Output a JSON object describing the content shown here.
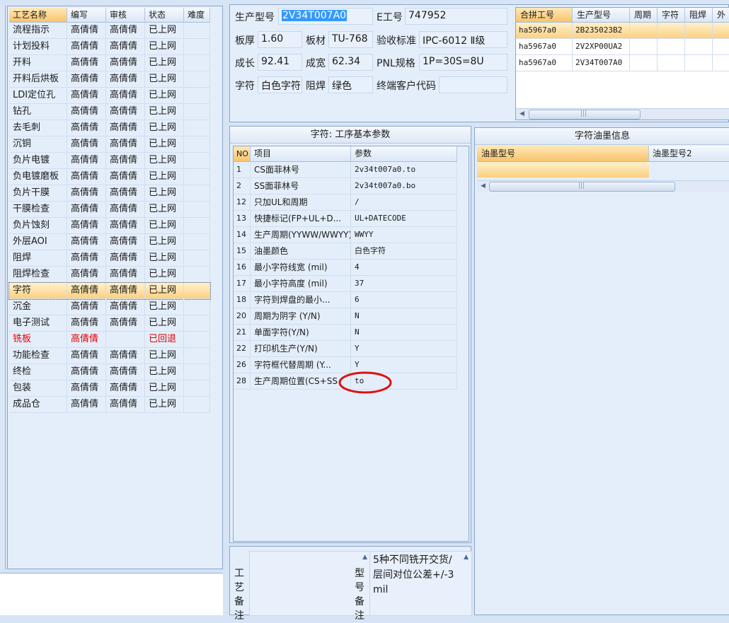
{
  "process_list": {
    "columns": [
      "工艺名称",
      "编写",
      "审核",
      "状态",
      "难度"
    ],
    "rows": [
      {
        "name": "流程指示",
        "writer": "高倩倩",
        "reviewer": "高倩倩",
        "status": "已上网"
      },
      {
        "name": "计划投料",
        "writer": "高倩倩",
        "reviewer": "高倩倩",
        "status": "已上网"
      },
      {
        "name": "开料",
        "writer": "高倩倩",
        "reviewer": "高倩倩",
        "status": "已上网"
      },
      {
        "name": "开料后烘板",
        "writer": "高倩倩",
        "reviewer": "高倩倩",
        "status": "已上网"
      },
      {
        "name": "LDI定位孔",
        "writer": "高倩倩",
        "reviewer": "高倩倩",
        "status": "已上网"
      },
      {
        "name": "钻孔",
        "writer": "高倩倩",
        "reviewer": "高倩倩",
        "status": "已上网"
      },
      {
        "name": "去毛刺",
        "writer": "高倩倩",
        "reviewer": "高倩倩",
        "status": "已上网"
      },
      {
        "name": "沉铜",
        "writer": "高倩倩",
        "reviewer": "高倩倩",
        "status": "已上网"
      },
      {
        "name": "负片电镀",
        "writer": "高倩倩",
        "reviewer": "高倩倩",
        "status": "已上网"
      },
      {
        "name": "负电镀磨板",
        "writer": "高倩倩",
        "reviewer": "高倩倩",
        "status": "已上网"
      },
      {
        "name": "负片干膜",
        "writer": "高倩倩",
        "reviewer": "高倩倩",
        "status": "已上网"
      },
      {
        "name": "干膜检查",
        "writer": "高倩倩",
        "reviewer": "高倩倩",
        "status": "已上网"
      },
      {
        "name": "负片蚀刻",
        "writer": "高倩倩",
        "reviewer": "高倩倩",
        "status": "已上网"
      },
      {
        "name": "外层AOI",
        "writer": "高倩倩",
        "reviewer": "高倩倩",
        "status": "已上网"
      },
      {
        "name": "阻焊",
        "writer": "高倩倩",
        "reviewer": "高倩倩",
        "status": "已上网"
      },
      {
        "name": "阻焊检查",
        "writer": "高倩倩",
        "reviewer": "高倩倩",
        "status": "已上网"
      },
      {
        "name": "字符",
        "writer": "高倩倩",
        "reviewer": "高倩倩",
        "status": "已上网",
        "selected": true
      },
      {
        "name": "沉金",
        "writer": "高倩倩",
        "reviewer": "高倩倩",
        "status": "已上网"
      },
      {
        "name": "电子测试",
        "writer": "高倩倩",
        "reviewer": "高倩倩",
        "status": "已上网"
      },
      {
        "name": "铣板",
        "writer": "高倩倩",
        "reviewer": "",
        "status": "已回退",
        "highlight": "red"
      },
      {
        "name": "功能检查",
        "writer": "高倩倩",
        "reviewer": "高倩倩",
        "status": "已上网"
      },
      {
        "name": "终检",
        "writer": "高倩倩",
        "reviewer": "高倩倩",
        "status": "已上网"
      },
      {
        "name": "包装",
        "writer": "高倩倩",
        "reviewer": "高倩倩",
        "status": "已上网"
      },
      {
        "name": "成品仓",
        "writer": "高倩倩",
        "reviewer": "高倩倩",
        "status": "已上网"
      }
    ]
  },
  "info": {
    "model_label": "生产型号",
    "model_value": "2V34T007A0",
    "ejob_label": "E工号",
    "ejob_value": "747952",
    "thickness_label": "板厚",
    "thickness_value": "1.60",
    "material_label": "板材",
    "material_value": "TU-768",
    "acceptance_label": "验收标准",
    "acceptance_value": "IPC-6012 Ⅱ级",
    "length_label": "成长",
    "length_value": "92.41",
    "width_label": "成宽",
    "width_value": "62.34",
    "pnl_label": "PNL规格",
    "pnl_value": "1P=30S=8U",
    "char_label": "字符",
    "char_value": "白色字符",
    "mask_label": "阻焊",
    "mask_value": "绿色",
    "customer_code_label": "终端客户代码",
    "customer_code_value": ""
  },
  "combine": {
    "columns": [
      "合拼工号",
      "生产型号",
      "周期",
      "字符",
      "阻焊",
      "外"
    ],
    "rows": [
      {
        "job": "ha5967a0",
        "model": "2B235023B2",
        "selected": true
      },
      {
        "job": "ha5967a0",
        "model": "2V2XP00UA2"
      },
      {
        "job": "ha5967a0",
        "model": "2V34T007A0"
      }
    ]
  },
  "params": {
    "title": "字符: 工序基本参数",
    "columns": [
      "NO",
      "项目",
      "参数"
    ],
    "rows": [
      {
        "no": "1",
        "item": "CS面菲林号",
        "value": "2v34t007a0.to"
      },
      {
        "no": "2",
        "item": "SS面菲林号",
        "value": "2v34t007a0.bo"
      },
      {
        "no": "12",
        "item": "只加UL和周期",
        "value": "/"
      },
      {
        "no": "13",
        "item": "快捷标记(FP+UL+D...",
        "value": "UL+DATECODE"
      },
      {
        "no": "14",
        "item": "生产周期(YYWW/WWYY)",
        "value": "WWYY"
      },
      {
        "no": "15",
        "item": "油墨颜色",
        "value": "白色字符"
      },
      {
        "no": "16",
        "item": "最小字符线宽 (mil)",
        "value": "4"
      },
      {
        "no": "17",
        "item": "最小字符高度 (mil)",
        "value": "37"
      },
      {
        "no": "18",
        "item": "字符到焊盘的最小...",
        "value": "6"
      },
      {
        "no": "20",
        "item": "周期为阴字 (Y/N)",
        "value": "N"
      },
      {
        "no": "21",
        "item": "单面字符(Y/N)",
        "value": "N"
      },
      {
        "no": "22",
        "item": "打印机生产(Y/N)",
        "value": "Y"
      },
      {
        "no": "26",
        "item": "字符框代替周期 (Y...",
        "value": "Y"
      },
      {
        "no": "28",
        "item": "生产周期位置(CS+SS",
        "value": "to"
      }
    ]
  },
  "ink": {
    "title": "字符油墨信息",
    "columns": [
      "油墨型号",
      "油墨型号2"
    ]
  },
  "remarks": {
    "process_label": "工艺备注",
    "model_label": "型号备注",
    "model_text": "5种不同铣开交货/层间对位公差+/-3mil"
  },
  "colors": {
    "selection": "#f8c36b",
    "annotation": "#e01010",
    "returned": "#e00000"
  }
}
